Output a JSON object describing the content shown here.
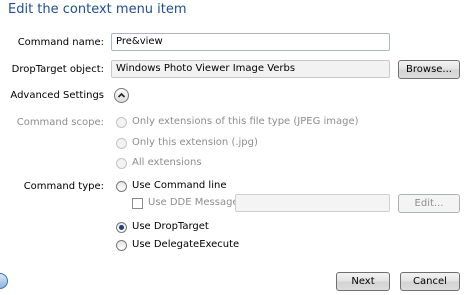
{
  "dialog": {
    "title": "Edit the context menu item"
  },
  "form": {
    "command_name": {
      "label": "Command name:",
      "value": "Pre&view"
    },
    "drop_target": {
      "label": "DropTarget object:",
      "value": "Windows Photo Viewer Image Verbs",
      "browse_label": "Browse..."
    },
    "advanced_label": "Advanced Settings",
    "command_scope": {
      "label": "Command scope:",
      "options": [
        "Only extensions of this file type (JPEG image)",
        "Only this extension (.jpg)",
        "All extensions"
      ]
    },
    "command_type": {
      "label": "Command type:",
      "use_command_line": "Use Command line",
      "use_dde": "Use DDE Message",
      "dde_value": "",
      "edit_label": "Edit...",
      "use_droptarget": "Use DropTarget",
      "use_delegate": "Use DelegateExecute",
      "selected": "Use DropTarget"
    }
  },
  "footer": {
    "next_label": "Next",
    "cancel_label": "Cancel"
  },
  "colors": {
    "title": "#1f4e97",
    "disabled_text": "#8d8d8d",
    "selected_radio": "#1e3f7a"
  },
  "icons": {
    "advanced_toggle": "chevron-up-icon",
    "help": "help-icon"
  }
}
